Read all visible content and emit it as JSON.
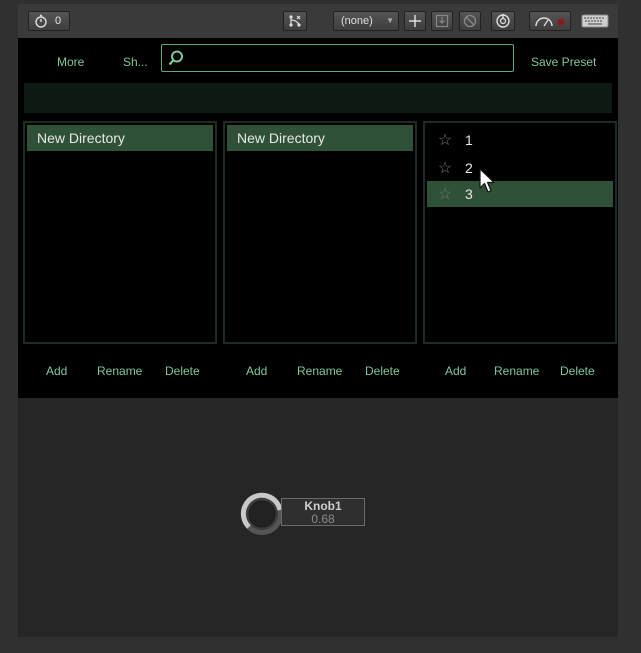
{
  "toolbar": {
    "timer_count": "0",
    "preset_select": "(none)",
    "icons": [
      "stopwatch-icon",
      "routing-icon",
      "plus-icon",
      "save-icon",
      "block-icon",
      "power-icon",
      "cpu-meter-icon",
      "keyboard-icon"
    ]
  },
  "browser": {
    "more_label": "More",
    "show_label": "Sh...",
    "search_value": "",
    "save_preset_label": "Save Preset",
    "columns": [
      {
        "items": [
          {
            "label": "New Directory",
            "selected": true
          }
        ],
        "actions": [
          "Add",
          "Rename",
          "Delete"
        ]
      },
      {
        "items": [
          {
            "label": "New Directory",
            "selected": true
          }
        ],
        "actions": [
          "Add",
          "Rename",
          "Delete"
        ]
      },
      {
        "items": [
          {
            "label": "1",
            "selected": false
          },
          {
            "label": "2",
            "selected": false
          },
          {
            "label": "3",
            "selected": true
          }
        ],
        "actions": [
          "Add",
          "Rename",
          "Delete"
        ]
      }
    ]
  },
  "knob": {
    "name": "Knob1",
    "value": "0.68"
  },
  "colors": {
    "accent": "#7ec79a",
    "selection": "#2f5138",
    "panel_bg": "#000000",
    "frame_bg": "#262626"
  }
}
